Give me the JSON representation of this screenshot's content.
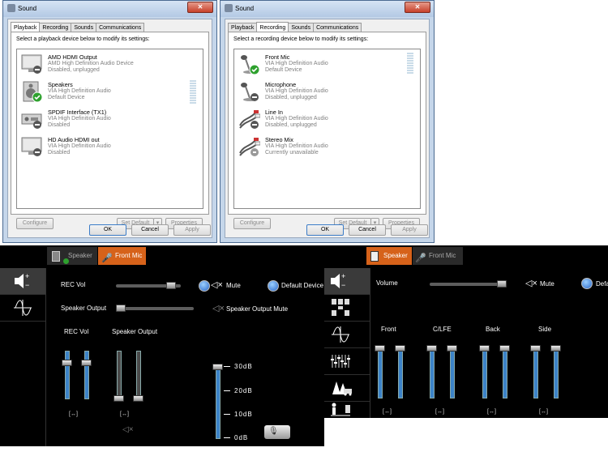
{
  "playback_window": {
    "title": "Sound",
    "tabs": [
      "Playback",
      "Recording",
      "Sounds",
      "Communications"
    ],
    "active_tab": "Playback",
    "instruction": "Select a playback device below to modify its settings:",
    "devices": [
      {
        "name": "AMD HDMI Output",
        "driver": "AMD High Definition Audio Device",
        "status": "Disabled, unplugged",
        "icon": "monitor-icon"
      },
      {
        "name": "Speakers",
        "driver": "VIA High Definition Audio",
        "status": "Default Device",
        "icon": "speaker-icon",
        "default": true
      },
      {
        "name": "SPDIF Interface (TX1)",
        "driver": "VIA High Definition Audio",
        "status": "Disabled",
        "icon": "spdif-icon"
      },
      {
        "name": "HD Audio HDMI out",
        "driver": "VIA High Definition Audio",
        "status": "Disabled",
        "icon": "monitor-icon"
      }
    ],
    "buttons": {
      "configure": "Configure",
      "set_default": "Set Default",
      "properties": "Properties",
      "ok": "OK",
      "cancel": "Cancel",
      "apply": "Apply"
    }
  },
  "recording_window": {
    "title": "Sound",
    "tabs": [
      "Playback",
      "Recording",
      "Sounds",
      "Communications"
    ],
    "active_tab": "Recording",
    "instruction": "Select a recording device below to modify its settings:",
    "devices": [
      {
        "name": "Front Mic",
        "driver": "VIA High Definition Audio",
        "status": "Default Device",
        "icon": "microphone-icon",
        "default": true
      },
      {
        "name": "Microphone",
        "driver": "VIA High Definition Audio",
        "status": "Disabled, unplugged",
        "icon": "microphone-icon"
      },
      {
        "name": "Line In",
        "driver": "VIA High Definition Audio",
        "status": "Disabled, unplugged",
        "icon": "rca-cable-icon"
      },
      {
        "name": "Stereo Mix",
        "driver": "VIA High Definition Audio",
        "status": "Currently unavailable",
        "icon": "rca-cable-icon"
      }
    ],
    "buttons": {
      "configure": "Configure",
      "set_default": "Set Default",
      "properties": "Properties",
      "ok": "OK",
      "cancel": "Cancel",
      "apply": "Apply"
    }
  },
  "mic_panel": {
    "tabs": [
      {
        "label": "Speaker",
        "active": false
      },
      {
        "label": "Front Mic",
        "active": true
      }
    ],
    "rec_vol_label": "REC Vol",
    "rec_vol_level": 0.95,
    "mute_label": "Mute",
    "default_device_label": "Default Device",
    "speaker_output_label": "Speaker Output",
    "speaker_output_level": 0.05,
    "speaker_output_mute_label": "Speaker Output Mute",
    "col_rec_vol": "REC Vol",
    "col_speaker_output": "Speaker Output",
    "boost_scale": [
      "30dB",
      "20dB",
      "10dB",
      "0dB"
    ],
    "boost_level": "30dB"
  },
  "speaker_panel": {
    "tabs": [
      {
        "label": "Speaker",
        "active": true
      },
      {
        "label": "Front Mic",
        "active": false
      }
    ],
    "volume_label": "Volume",
    "volume_level": 1.0,
    "mute_label": "Mute",
    "default_label": "Defa",
    "channels": [
      "Front",
      "C/LFE",
      "Back",
      "Side"
    ]
  },
  "colors": {
    "accent_orange": "#d6621a",
    "slider_blue": "#3c83c8",
    "panel_black": "#000000"
  }
}
